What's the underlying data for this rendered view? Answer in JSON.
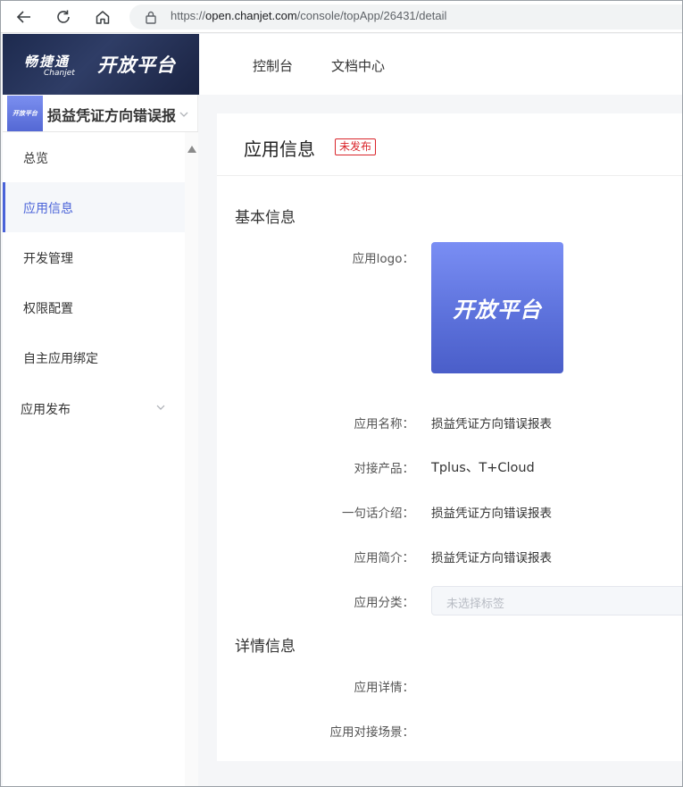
{
  "browser": {
    "url_prefix": "https://",
    "url_host": "open.chanjet.com",
    "url_path": "/console/topApp/26431/detail"
  },
  "brand": {
    "name_cn": "畅捷通",
    "name_en": "Chanjet",
    "platform": "开放平台"
  },
  "header": {
    "links": [
      "控制台",
      "文档中心"
    ]
  },
  "sidebar": {
    "thumb_text": "开放平台",
    "app_name": "损益凭证方向错误报",
    "items": [
      {
        "label": "总览"
      },
      {
        "label": "应用信息"
      },
      {
        "label": "开发管理"
      },
      {
        "label": "权限配置"
      },
      {
        "label": "自主应用绑定"
      },
      {
        "label": "应用发布"
      }
    ]
  },
  "main": {
    "title": "应用信息",
    "status": "未发布",
    "basic_section": "基本信息",
    "detail_section": "详情信息",
    "logo_label": "应用logo：",
    "logo_text": "开放平台",
    "fields": {
      "name_label": "应用名称：",
      "name_value": "损益凭证方向错误报表",
      "product_label": "对接产品：",
      "product_value": "Tplus、T+Cloud",
      "intro_label": "一句话介绍：",
      "intro_value": "损益凭证方向错误报表",
      "summary_label": "应用简介：",
      "summary_value": "损益凭证方向错误报表",
      "category_label": "应用分类：",
      "category_placeholder": "未选择标签",
      "detail_label": "应用详情：",
      "scenario_label": "应用对接场景："
    }
  },
  "colors": {
    "accent": "#4a63d8",
    "status_red": "#d9252b",
    "brand_dark": "#1d2a4e"
  }
}
